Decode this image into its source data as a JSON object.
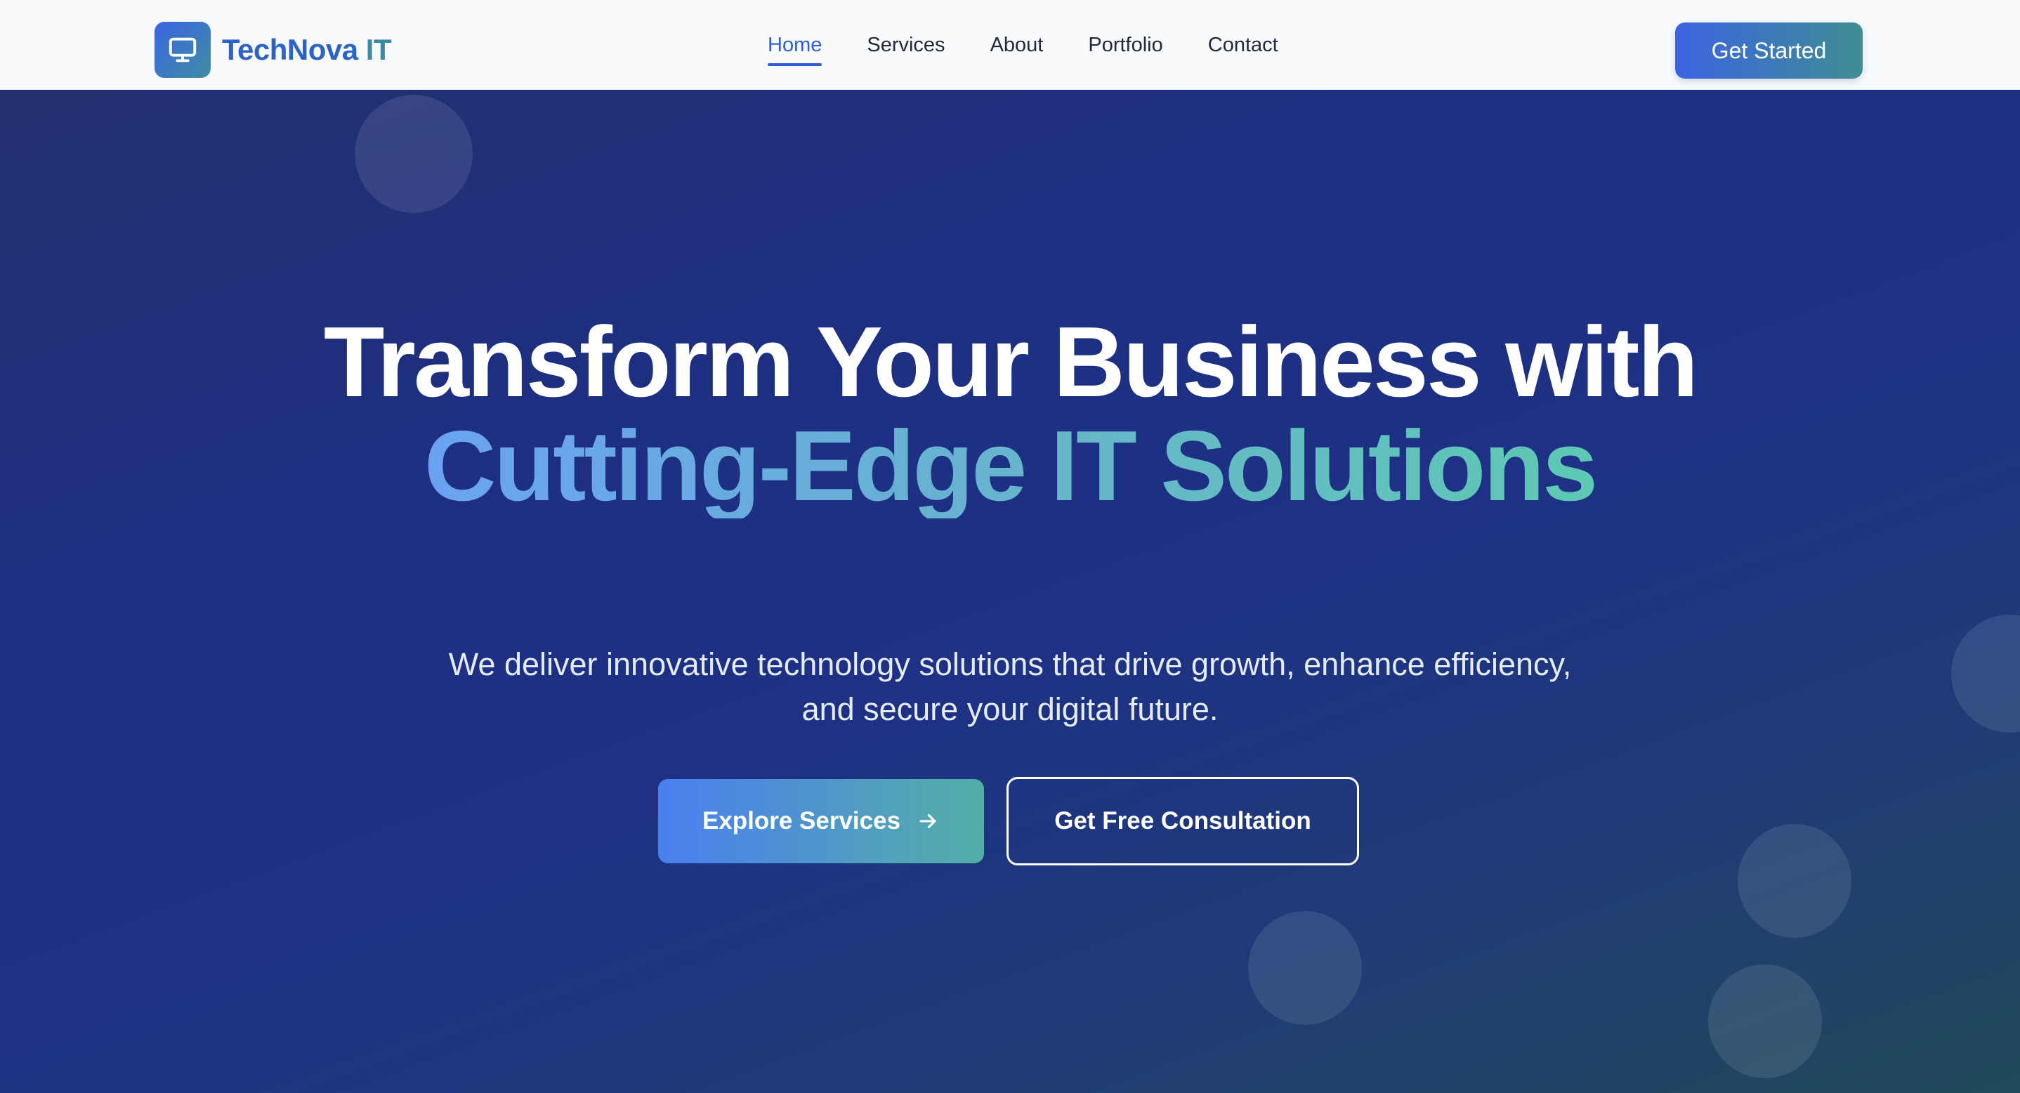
{
  "brand": {
    "name": "TechNova",
    "suffix": "IT",
    "logo_icon": "monitor-icon"
  },
  "nav": {
    "items": [
      {
        "label": "Home",
        "active": true
      },
      {
        "label": "Services",
        "active": false
      },
      {
        "label": "About",
        "active": false
      },
      {
        "label": "Portfolio",
        "active": false
      },
      {
        "label": "Contact",
        "active": false
      }
    ],
    "cta_label": "Get Started"
  },
  "hero": {
    "headline_line1": "Transform Your Business with",
    "headline_line2": "Cutting-Edge IT Solutions",
    "subtext": "We deliver innovative technology solutions that drive growth, enhance efficiency, and secure your digital future.",
    "primary_button": "Explore Services",
    "primary_button_icon": "arrow-right-icon",
    "secondary_button": "Get Free Consultation"
  },
  "colors": {
    "brand_blue": "#2d5fd3",
    "brand_teal": "#3f8e93",
    "hero_background": "#1e2f82",
    "headline_gradient_start": "#6aa2f2",
    "headline_gradient_end": "#5ec9b4"
  }
}
